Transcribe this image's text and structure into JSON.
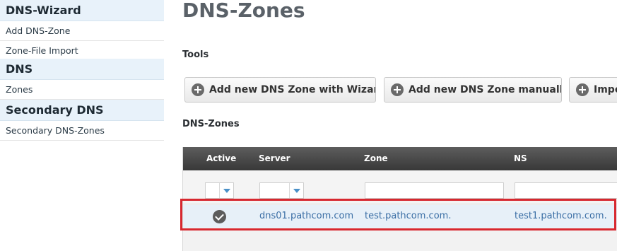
{
  "sidebar": {
    "sections": [
      {
        "title": "DNS-Wizard",
        "items": [
          "Add DNS-Zone",
          "Zone-File Import"
        ]
      },
      {
        "title": "DNS",
        "items": [
          "Zones"
        ]
      },
      {
        "title": "Secondary DNS",
        "items": [
          "Secondary DNS-Zones"
        ]
      }
    ]
  },
  "main": {
    "title": "DNS-Zones",
    "tools_label": "Tools",
    "tools": [
      "Add new DNS Zone with Wizard",
      "Add new DNS Zone manually",
      "Import Zone File"
    ],
    "zones_label": "DNS-Zones",
    "grid": {
      "columns": [
        "Active",
        "Server",
        "Zone",
        "NS"
      ],
      "rows": [
        {
          "active": true,
          "server": "dns01.pathcom.com",
          "zone": "test.pathcom.com.",
          "ns": "test1.pathcom.com."
        }
      ]
    }
  },
  "colors": {
    "highlight": "#d7282f",
    "link": "#3a6ea5",
    "sidebar_header_bg": "#e8f2fa"
  },
  "icons": {
    "tool_button": "plus-circle-icon",
    "active": "check-circle-icon",
    "dropdown": "dropdown-arrow-icon"
  }
}
